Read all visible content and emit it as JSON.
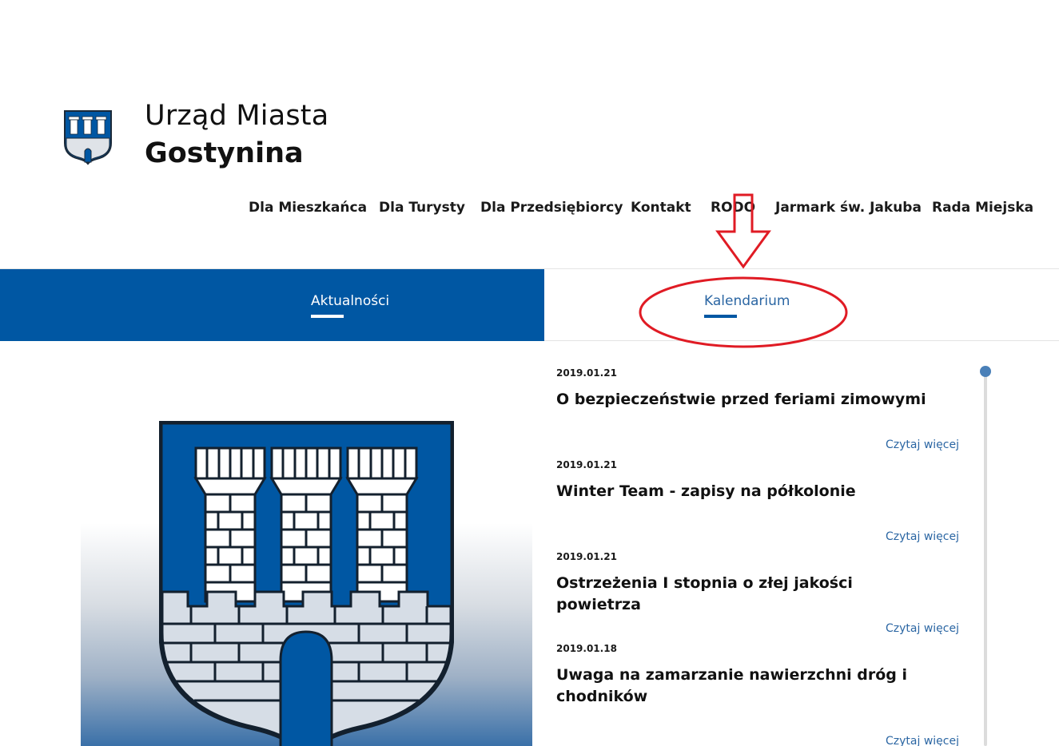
{
  "header": {
    "title_line1": "Urząd Miasta",
    "title_line2": "Gostynina",
    "logo_icon": "coat-of-arms-icon"
  },
  "nav": {
    "items": [
      {
        "label": "Dla Mieszkańca"
      },
      {
        "label": "Dla Turysty"
      },
      {
        "label": "Dla Przedsiębiorcy"
      },
      {
        "label": "Kontakt"
      },
      {
        "label": "RODO"
      },
      {
        "label": "Jarmark św. Jakuba"
      },
      {
        "label": "Rada Miejska"
      }
    ]
  },
  "tabs": [
    {
      "label": "Aktualności",
      "active": true
    },
    {
      "label": "Kalendarium",
      "active": false
    }
  ],
  "news": [
    {
      "date": "2019.01.21",
      "title": "O bezpieczeństwie przed feriami zimowymi",
      "more": "Czytaj więcej"
    },
    {
      "date": "2019.01.21",
      "title": "Winter Team - zapisy na półkolonie",
      "more": "Czytaj więcej"
    },
    {
      "date": "2019.01.21",
      "title": "Ostrzeżenia I stopnia o złej jakości powietrza",
      "more": "Czytaj więcej"
    },
    {
      "date": "2019.01.18",
      "title": "Uwaga na zamarzanie nawierzchni dróg i chodników",
      "more": "Czytaj więcej"
    }
  ],
  "colors": {
    "brand_blue": "#0057a3",
    "link_blue": "#2b66a3",
    "annotation_red": "#e01b24"
  }
}
